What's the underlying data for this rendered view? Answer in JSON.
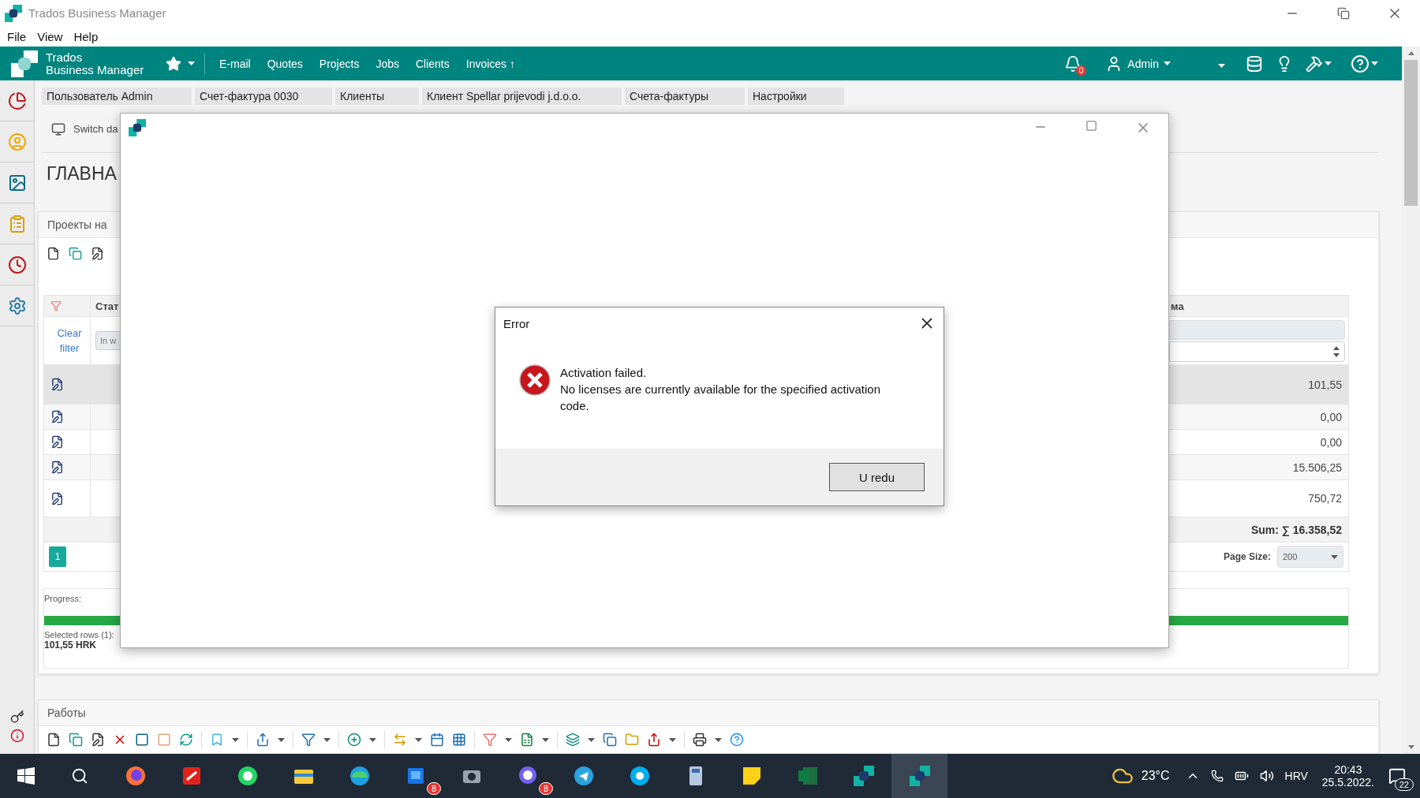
{
  "window": {
    "title": "Trados Business Manager"
  },
  "menu": [
    "File",
    "View",
    "Help"
  ],
  "navbar": {
    "brand": [
      "Trados",
      "Business Manager"
    ],
    "links": [
      "E-mail",
      "Quotes",
      "Projects",
      "Jobs",
      "Clients",
      "Invoices ↑"
    ],
    "notifications": "0",
    "user": "Admin"
  },
  "tabs": [
    "Пользователь Admin",
    "Счет-фактура 0030",
    "Клиенты",
    "Клиент Spellar prijevodi j.d.o.o.",
    "Счета-фактуры",
    "Настройки"
  ],
  "dashboard": {
    "switch_label": "Switch da",
    "heading": "ГЛАВНА"
  },
  "projects_panel": {
    "title": "Проекты на",
    "table": {
      "columns": [
        "Стат",
        "ма"
      ],
      "clear_filter": "Clear filter",
      "status_filter": "In w",
      "rows": [
        {
          "amount": "101,55",
          "selected": true
        },
        {
          "amount": "0,00",
          "selected": false
        },
        {
          "amount": "0,00",
          "selected": false
        },
        {
          "amount": "15.506,25",
          "selected": false
        },
        {
          "amount": "750,72",
          "selected": false
        }
      ],
      "sum": "Sum: ∑ 16.358,52",
      "pages": [
        {
          "label": "1",
          "selected": true
        }
      ],
      "page_size_label": "Page Size:",
      "page_size": "200"
    },
    "progress": {
      "label": "Progress:",
      "level": 1,
      "selected_rows": "Selected rows (1):",
      "selected_total": "101,55 HRK"
    }
  },
  "jobs_panel": {
    "title": "Работы"
  },
  "dialog": {
    "title": "Error",
    "heading": "Activation failed.",
    "message": "No licenses are currently available for the specified activation code.",
    "button": "U redu"
  },
  "taskbar": {
    "apps": [
      {
        "kind": "fox",
        "active": false
      },
      {
        "kind": "pdf",
        "active": false
      },
      {
        "kind": "phone",
        "active": false
      },
      {
        "kind": "folder",
        "active": false
      },
      {
        "kind": "wave",
        "active": false
      },
      {
        "kind": "tiles",
        "active": false,
        "badge": "8"
      },
      {
        "kind": "camera",
        "active": false
      },
      {
        "kind": "bubble",
        "active": false,
        "badge": "8"
      },
      {
        "kind": "plane",
        "active": false
      },
      {
        "kind": "ring",
        "active": false
      },
      {
        "kind": "calc",
        "active": false
      },
      {
        "kind": "note",
        "active": false
      },
      {
        "kind": "sheet",
        "active": false
      },
      {
        "kind": "logo",
        "active": false
      },
      {
        "kind": "logo",
        "active": true
      }
    ],
    "temperature": "23°C",
    "language": "HRV",
    "time": "20:43",
    "date": "25.5.2022.",
    "notifications": "22"
  }
}
